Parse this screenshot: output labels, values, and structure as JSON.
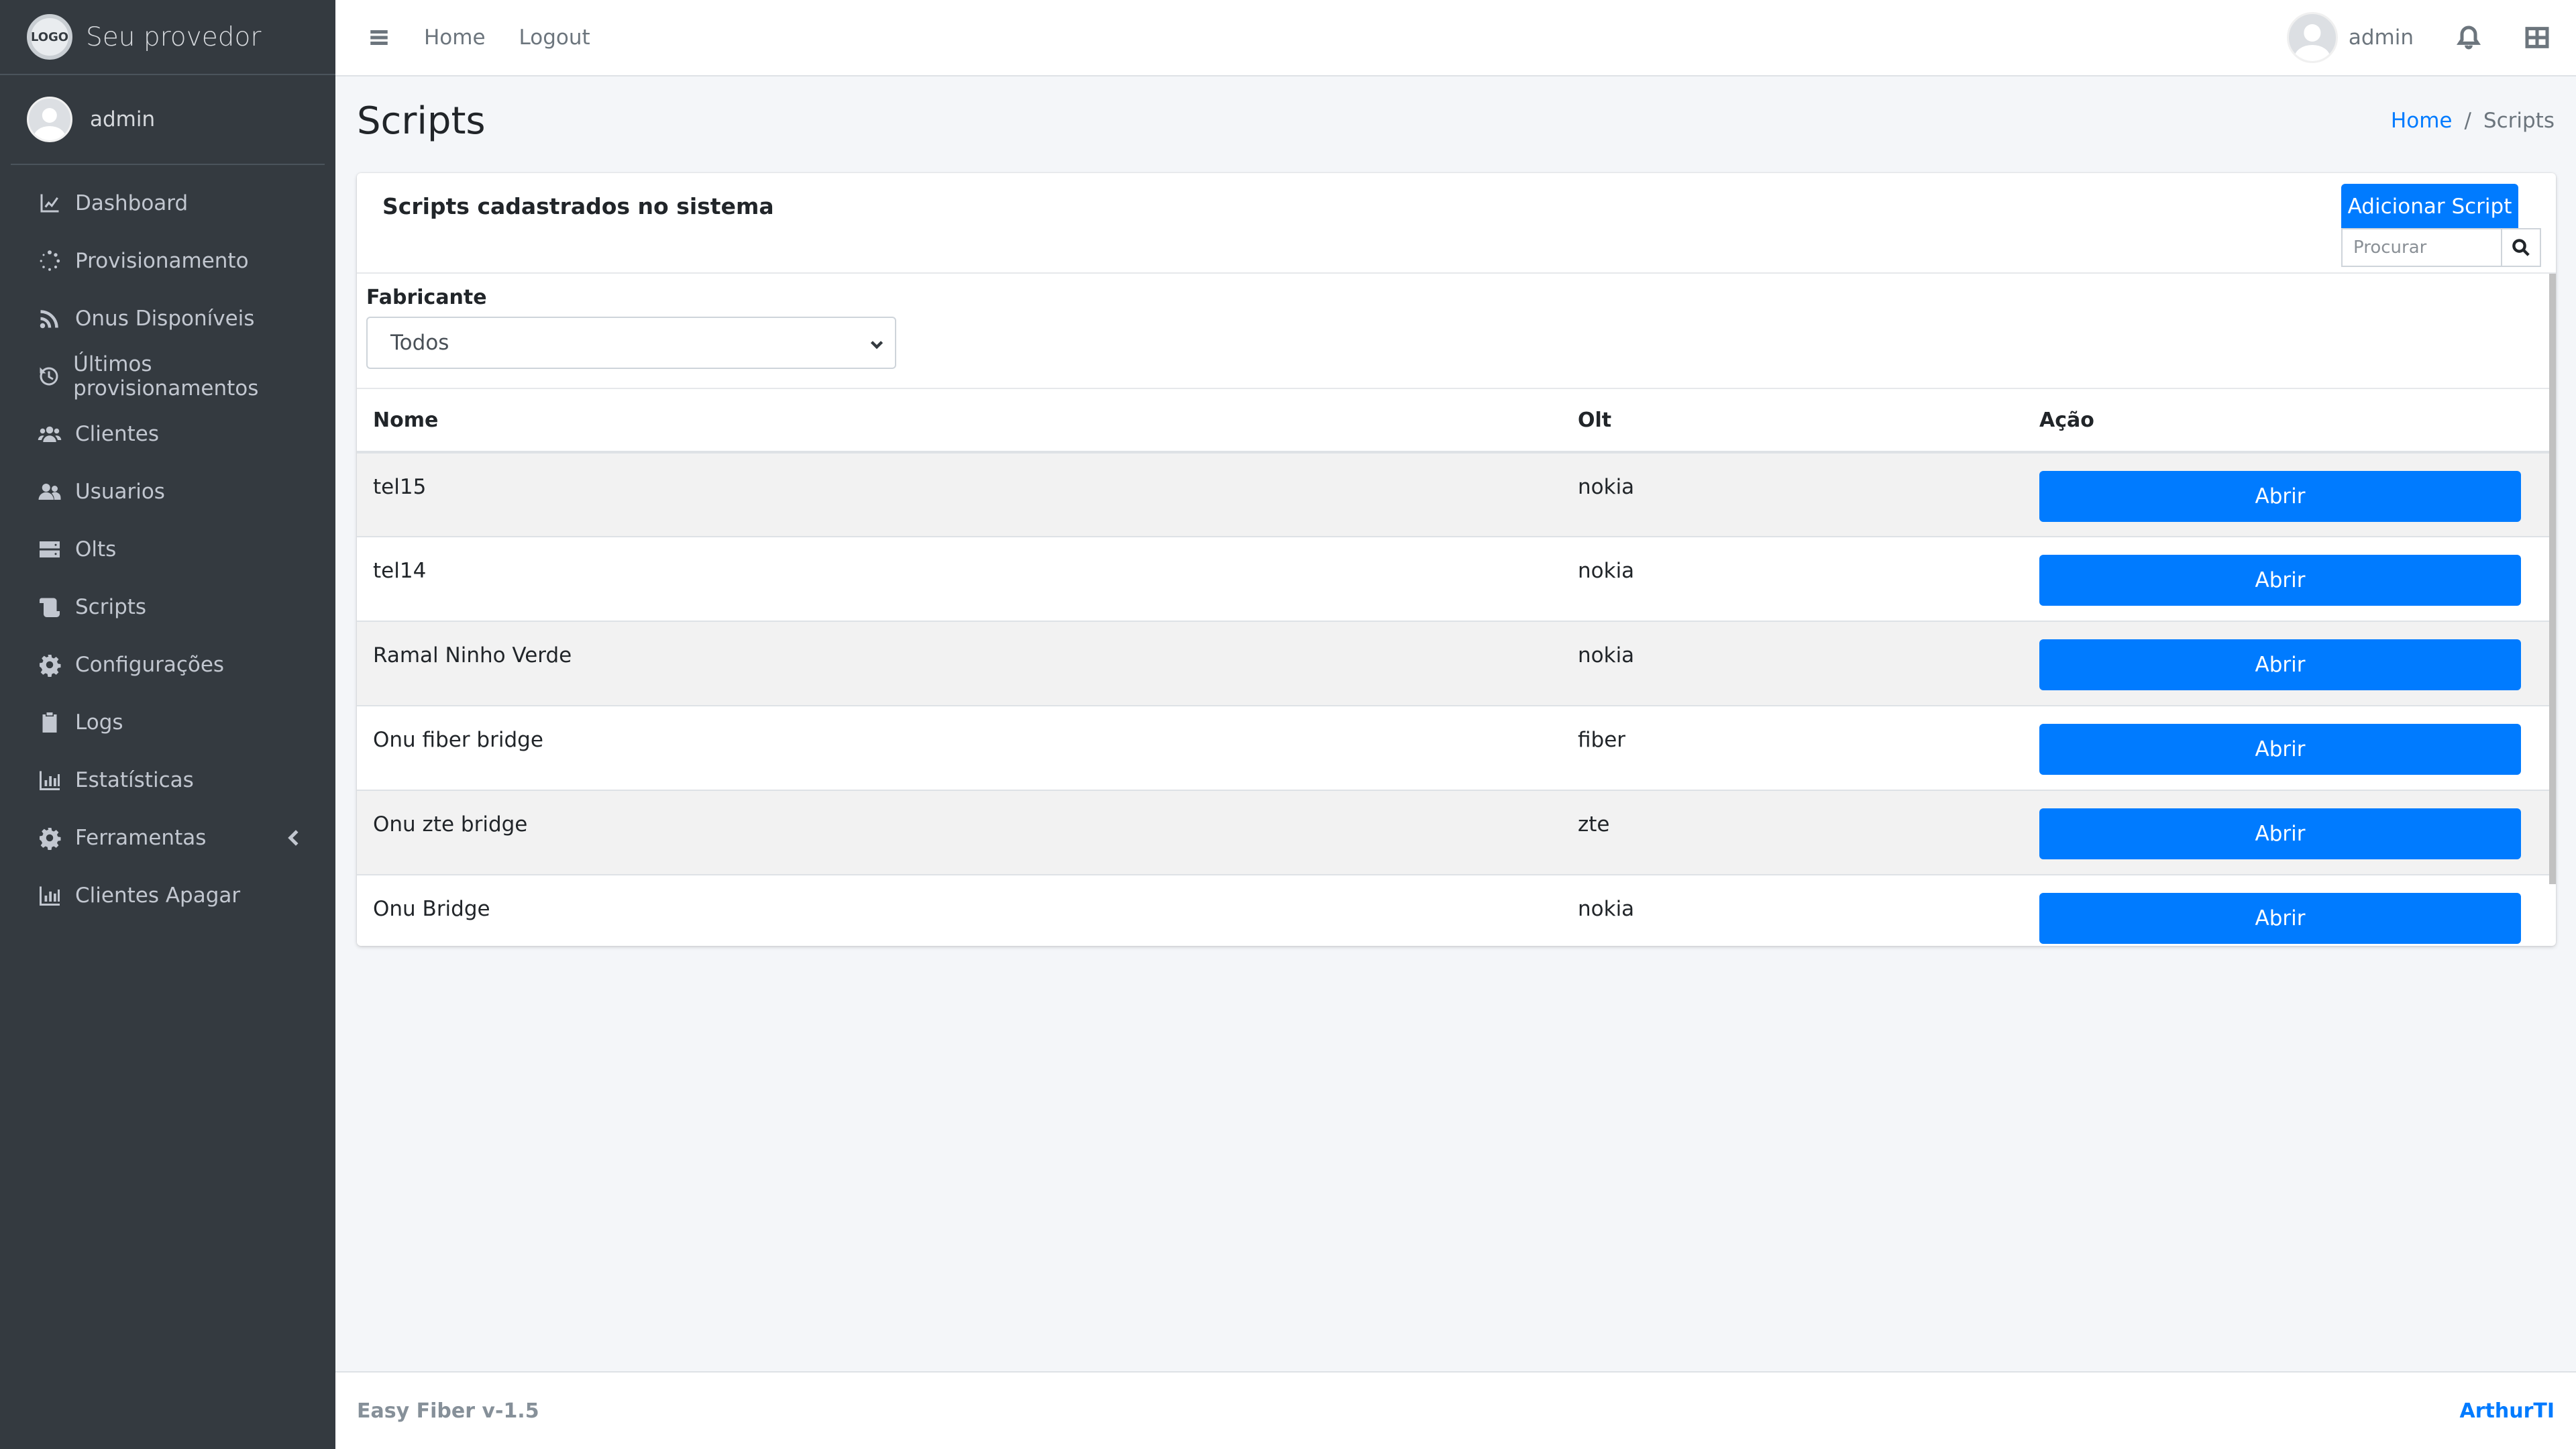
{
  "brand": {
    "name": "Seu provedor",
    "logo_text": "LOGO"
  },
  "user": {
    "name": "admin"
  },
  "sidebar": {
    "items": [
      {
        "label": "Dashboard",
        "icon": "chart-line-icon"
      },
      {
        "label": "Provisionamento",
        "icon": "spinner-icon"
      },
      {
        "label": "Onus Disponíveis",
        "icon": "rss-icon"
      },
      {
        "label": "Últimos provisionamentos",
        "icon": "history-icon"
      },
      {
        "label": "Clientes",
        "icon": "users-icon"
      },
      {
        "label": "Usuarios",
        "icon": "user-friends-icon"
      },
      {
        "label": "Olts",
        "icon": "server-icon"
      },
      {
        "label": "Scripts",
        "icon": "scroll-icon"
      },
      {
        "label": "Configurações",
        "icon": "gear-icon"
      },
      {
        "label": "Logs",
        "icon": "clipboard-icon"
      },
      {
        "label": "Estatísticas",
        "icon": "bar-chart-icon"
      },
      {
        "label": "Ferramentas",
        "icon": "gear-icon"
      },
      {
        "label": "Clientes Apagar",
        "icon": "bar-chart-icon"
      }
    ]
  },
  "topbar": {
    "links": [
      "Home",
      "Logout"
    ],
    "user": "admin"
  },
  "page": {
    "title": "Scripts",
    "breadcrumb": {
      "home": "Home",
      "separator": "/",
      "current": "Scripts"
    }
  },
  "card": {
    "title": "Scripts cadastrados no sistema",
    "add_button": "Adicionar Script",
    "search_placeholder": "Procurar",
    "filter_label": "Fabricante",
    "filter_value": "Todos"
  },
  "table": {
    "headers": [
      "Nome",
      "Olt",
      "Ação"
    ],
    "action_label": "Abrir",
    "rows": [
      {
        "nome": "tel15",
        "olt": "nokia"
      },
      {
        "nome": "tel14",
        "olt": "nokia"
      },
      {
        "nome": "Ramal Ninho Verde",
        "olt": "nokia"
      },
      {
        "nome": "Onu fiber bridge",
        "olt": "fiber"
      },
      {
        "nome": "Onu zte bridge",
        "olt": "zte"
      },
      {
        "nome": "Onu Bridge",
        "olt": "nokia"
      }
    ]
  },
  "footer": {
    "left": "Easy Fiber v-1.5",
    "right": "ArthurTI"
  },
  "colors": {
    "primary": "#007bff",
    "sidebar": "#343a40",
    "background": "#f4f6f9"
  }
}
